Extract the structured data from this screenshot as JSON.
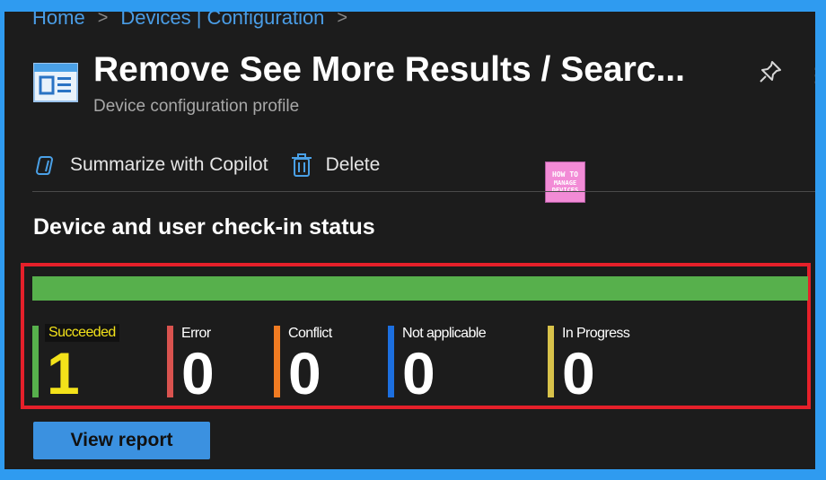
{
  "breadcrumb": [
    {
      "label": "Home"
    },
    {
      "label": "Devices | Configuration"
    }
  ],
  "header": {
    "title": "Remove See More Results / Searc...",
    "subtitle": "Device configuration profile",
    "icons": {
      "title": "profile-icon",
      "pin": "pin-icon",
      "more": "ellipsis-icon"
    }
  },
  "toolbar": {
    "copilot_label": "Summarize with Copilot",
    "delete_label": "Delete"
  },
  "logo": {
    "line1": "HOW TO",
    "line2": "MANAGE",
    "line3": "DEVICES"
  },
  "section": {
    "title": "Device and user check-in status"
  },
  "progress": {
    "succeeded_fraction": 1.0,
    "fill_color": "#57b04c"
  },
  "stats": [
    {
      "label": "Succeeded",
      "value": "1",
      "color": "#57b04c"
    },
    {
      "label": "Error",
      "value": "0",
      "color": "#d9534f"
    },
    {
      "label": "Conflict",
      "value": "0",
      "color": "#f07b22"
    },
    {
      "label": "Not applicable",
      "value": "0",
      "color": "#1c6fe0"
    },
    {
      "label": "In Progress",
      "value": "0",
      "color": "#d8c24a"
    }
  ],
  "actions": {
    "view_report_label": "View report"
  },
  "colors": {
    "accent": "#3b91e0",
    "highlight_border": "#e5202a",
    "page_border": "#2f9bf0"
  }
}
